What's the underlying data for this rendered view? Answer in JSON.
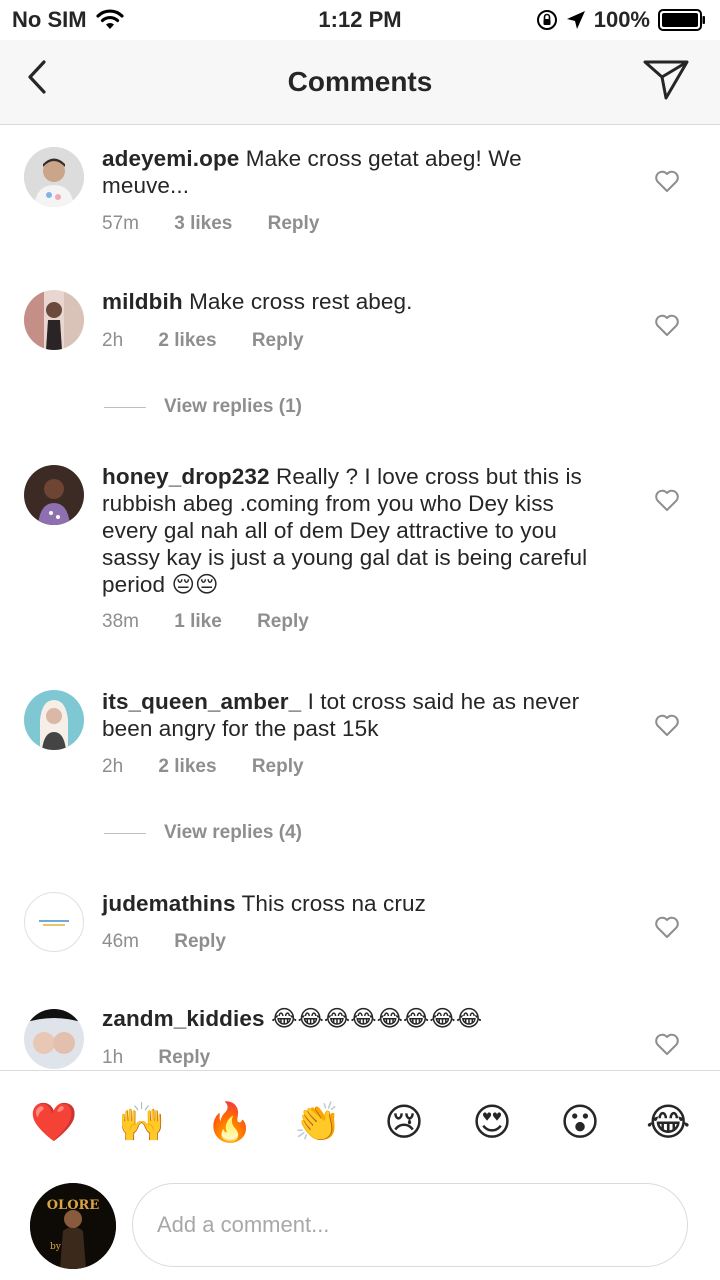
{
  "status_bar": {
    "carrier": "No SIM",
    "time": "1:12 PM",
    "battery": "100%"
  },
  "header": {
    "title": "Comments"
  },
  "comments": [
    {
      "username": "adeyemi.ope",
      "text": "Make cross getat abeg! We meuve...",
      "time": "57m",
      "likes": "3 likes",
      "reply": "Reply"
    },
    {
      "username": "mildbih",
      "text": "Make cross rest abeg.",
      "time": "2h",
      "likes": "2 likes",
      "reply": "Reply",
      "view_replies": "View replies (1)"
    },
    {
      "username": "honey_drop232",
      "text": "Really ?  I love cross but this is rubbish abeg .coming from you who Dey kiss every gal nah all of dem Dey attractive to you sassy kay is just a young gal dat is being careful period 😔😔",
      "time": "38m",
      "likes": "1 like",
      "reply": "Reply"
    },
    {
      "username": "its_queen_amber_",
      "text": "I tot cross said he as never been angry for the past 15k",
      "time": "2h",
      "likes": "2 likes",
      "reply": "Reply",
      "view_replies": "View replies (4)"
    },
    {
      "username": "judemathins",
      "text": "This cross na cruz",
      "time": "46m",
      "reply": "Reply"
    },
    {
      "username": "zandm_kiddies",
      "text": "😂😂😂😂😂😂😂😂",
      "time": "1h",
      "reply": "Reply"
    }
  ],
  "emoji_bar": [
    "❤️",
    "🙌",
    "🔥",
    "👏",
    "😢",
    "😍",
    "😮",
    "😂"
  ],
  "input": {
    "placeholder": "Add a comment..."
  },
  "my_avatar": {
    "text": "OLORE",
    "subtext": "by"
  },
  "colors": {
    "text": "#262626",
    "secondary": "#8e8e8e",
    "divider": "#dbdbdb",
    "header_bg": "#f7f7f7"
  }
}
